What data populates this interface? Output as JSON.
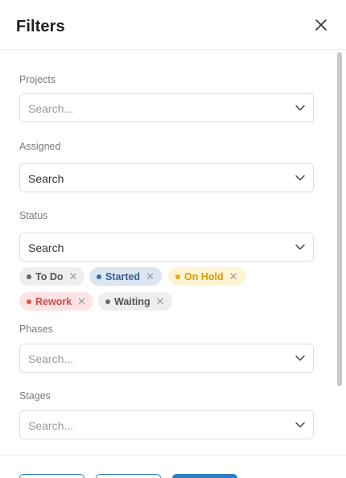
{
  "header": {
    "title": "Filters",
    "close_icon": "close-icon"
  },
  "fields": {
    "projects": {
      "label": "Projects",
      "placeholder": "Search..."
    },
    "assigned": {
      "label": "Assigned",
      "value": "Search"
    },
    "status": {
      "label": "Status",
      "value": "Search",
      "tags": [
        {
          "label": "To Do",
          "dot": "#6b6b6b",
          "bg": "#eeeeee",
          "fg": "#555555"
        },
        {
          "label": "Started",
          "dot": "#3a6ea5",
          "bg": "#dce6f2",
          "fg": "#3a5f8f"
        },
        {
          "label": "On Hold",
          "dot": "#f0a500",
          "bg": "#fff3d6",
          "fg": "#e09a00"
        },
        {
          "label": "Rework",
          "dot": "#e05252",
          "bg": "#fde4e4",
          "fg": "#d84545"
        },
        {
          "label": "Waiting",
          "dot": "#6b6b6b",
          "bg": "#eeeeee",
          "fg": "#555555"
        }
      ]
    },
    "phases": {
      "label": "Phases",
      "placeholder": "Search..."
    },
    "stages": {
      "label": "Stages",
      "placeholder": "Search..."
    }
  },
  "colors": {
    "accent": "#2f7fc8"
  }
}
